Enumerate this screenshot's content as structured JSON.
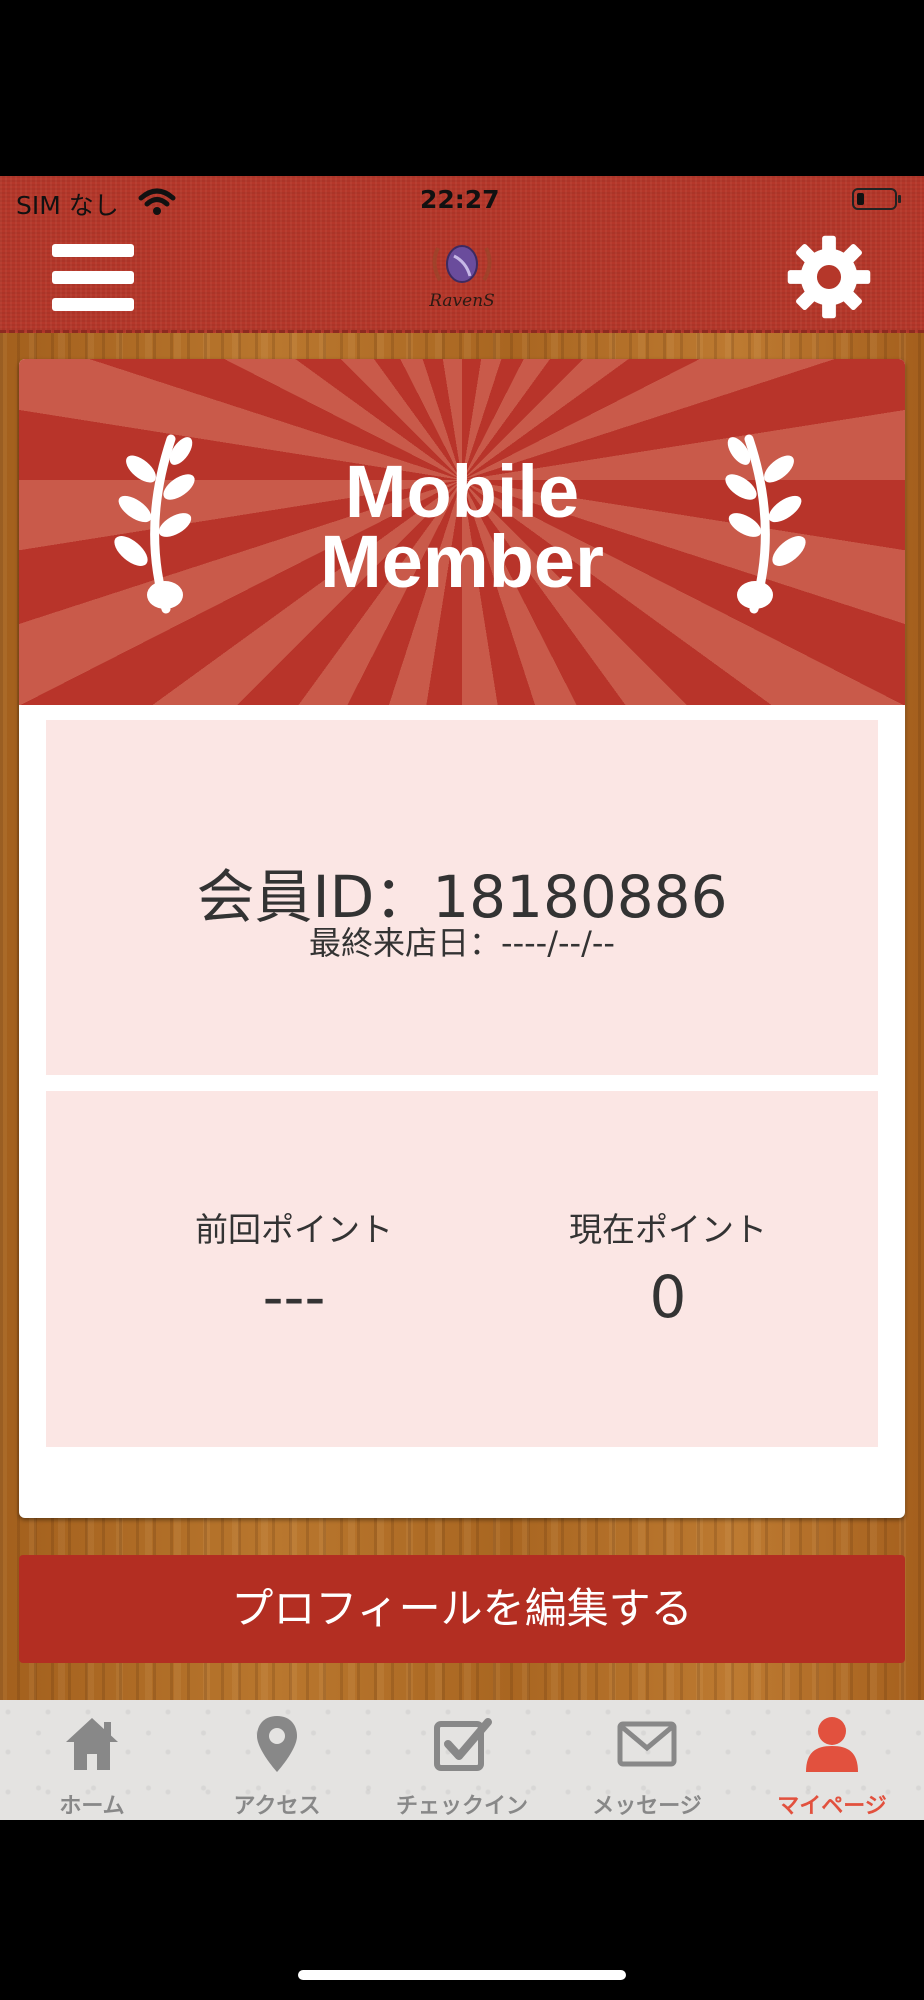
{
  "status_bar": {
    "carrier": "SIM なし",
    "time": "22:27"
  },
  "header": {
    "menu_icon": "hamburger-menu-icon",
    "logo_text": "RavenS",
    "settings_icon": "gear-icon"
  },
  "banner": {
    "title_line1": "Mobile",
    "title_line2": "Member"
  },
  "member": {
    "id_line": "会員ID：18180886",
    "last_visit_line": "最終来店日：----/--/--"
  },
  "points": {
    "previous_label": "前回ポイント",
    "previous_value": "---",
    "current_label": "現在ポイント",
    "current_value": "0"
  },
  "edit_button_label": "プロフィールを編集する",
  "tabs": [
    {
      "label": "ホーム",
      "icon": "home-icon",
      "active": false
    },
    {
      "label": "アクセス",
      "icon": "map-pin-icon",
      "active": false
    },
    {
      "label": "チェックイン",
      "icon": "checkbox-icon",
      "active": false
    },
    {
      "label": "メッセージ",
      "icon": "envelope-icon",
      "active": false
    },
    {
      "label": "マイページ",
      "icon": "person-icon",
      "active": true
    }
  ],
  "colors": {
    "brand_red": "#b32e22",
    "active_tab": "#e2513e",
    "pink_panel": "#fbe6e4"
  }
}
